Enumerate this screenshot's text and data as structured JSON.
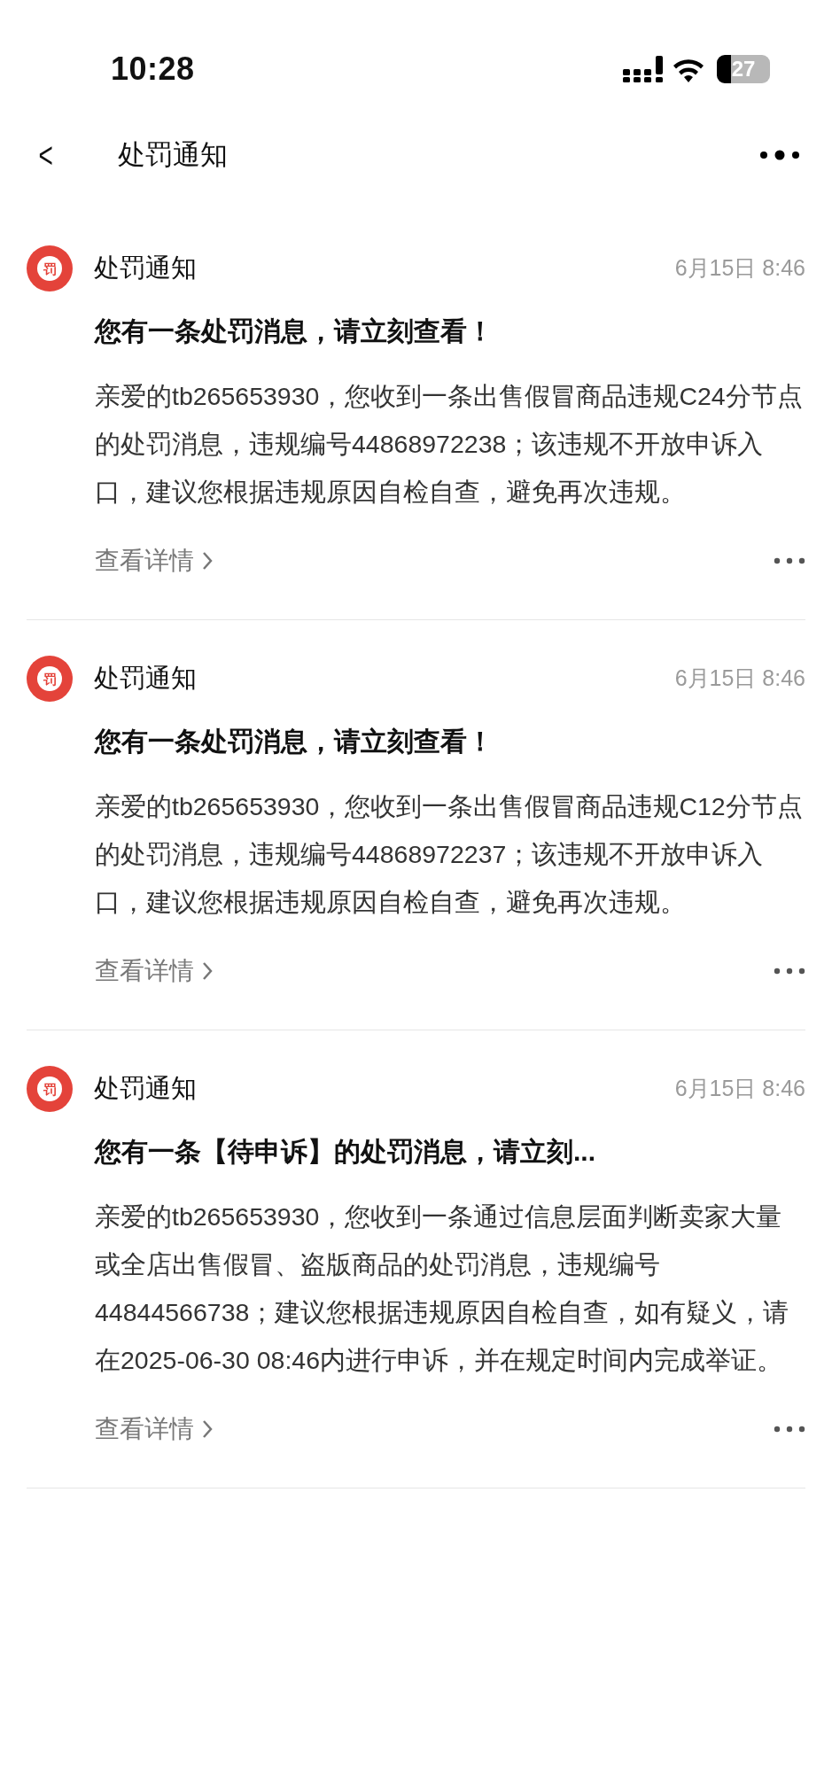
{
  "status_bar": {
    "time": "10:28",
    "battery": "27"
  },
  "nav": {
    "back": "<",
    "title": "处罚通知"
  },
  "messages": [
    {
      "icon_text": "罚",
      "sender": "处罚通知",
      "time": "6月15日 8:46",
      "title": "您有一条处罚消息，请立刻查看！",
      "body": "亲爱的tb265653930，您收到一条出售假冒商品违规C24分节点的处罚消息，违规编号44868972238；该违规不开放申诉入口，建议您根据违规原因自检自查，避免再次违规。",
      "link": "查看详情"
    },
    {
      "icon_text": "罚",
      "sender": "处罚通知",
      "time": "6月15日 8:46",
      "title": "您有一条处罚消息，请立刻查看！",
      "body": "亲爱的tb265653930，您收到一条出售假冒商品违规C12分节点的处罚消息，违规编号44868972237；该违规不开放申诉入口，建议您根据违规原因自检自查，避免再次违规。",
      "link": "查看详情"
    },
    {
      "icon_text": "罚",
      "sender": "处罚通知",
      "time": "6月15日 8:46",
      "title": "您有一条【待申诉】的处罚消息，请立刻...",
      "body": "亲爱的tb265653930，您收到一条通过信息层面判断卖家大量或全店出售假冒、盗版商品的处罚消息，违规编号44844566738；建议您根据违规原因自检自查，如有疑义，请在2025-06-30 08:46内进行申诉，并在规定时间内完成举证。",
      "link": "查看详情"
    }
  ]
}
